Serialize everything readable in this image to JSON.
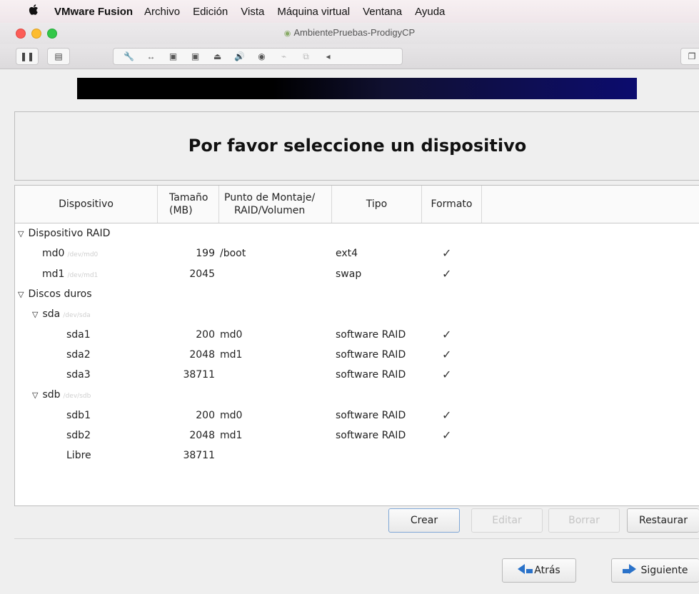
{
  "menubar": {
    "apple": "",
    "app": "VMware Fusion",
    "items": [
      "Archivo",
      "Edición",
      "Vista",
      "Máquina virtual",
      "Ventana",
      "Ayuda"
    ]
  },
  "window": {
    "title": "AmbientePruebas-ProdigyCP"
  },
  "toolbar": {
    "pause": "❚❚",
    "snapshot": "▤",
    "tools": [
      "🔧",
      "↔",
      "▣",
      "▣",
      "⏏",
      "🔊",
      "◉",
      "⌁",
      "⧉",
      "◂"
    ],
    "fullscreen": "❐"
  },
  "installer": {
    "heading": "Por favor seleccione un dispositivo",
    "columns": {
      "device": "Dispositivo",
      "size": "Tamaño\n(MB)",
      "mount": "Punto de Montaje/\nRAID/Volumen",
      "type": "Tipo",
      "format": "Formato"
    },
    "rows": [
      {
        "name": "Dispositivo RAID",
        "path": "",
        "size": "",
        "mount": "",
        "type": "",
        "format": false,
        "group": true,
        "level": 0
      },
      {
        "name": "md0",
        "path": "/dev/md0",
        "size": "199",
        "mount": "/boot",
        "type": "ext4",
        "format": true,
        "group": false,
        "level": 1
      },
      {
        "name": "md1",
        "path": "/dev/md1",
        "size": "2045",
        "mount": "",
        "type": "swap",
        "format": true,
        "group": false,
        "level": 1
      },
      {
        "name": "Discos duros",
        "path": "",
        "size": "",
        "mount": "",
        "type": "",
        "format": false,
        "group": true,
        "level": 0
      },
      {
        "name": "sda",
        "path": "/dev/sda",
        "size": "",
        "mount": "",
        "type": "",
        "format": false,
        "group": true,
        "level": 1
      },
      {
        "name": "sda1",
        "path": "",
        "size": "200",
        "mount": "md0",
        "type": "software RAID",
        "format": true,
        "group": false,
        "level": 2
      },
      {
        "name": "sda2",
        "path": "",
        "size": "2048",
        "mount": "md1",
        "type": "software RAID",
        "format": true,
        "group": false,
        "level": 2
      },
      {
        "name": "sda3",
        "path": "",
        "size": "38711",
        "mount": "",
        "type": "software RAID",
        "format": true,
        "group": false,
        "level": 2
      },
      {
        "name": "sdb",
        "path": "/dev/sdb",
        "size": "",
        "mount": "",
        "type": "",
        "format": false,
        "group": true,
        "level": 1
      },
      {
        "name": "sdb1",
        "path": "",
        "size": "200",
        "mount": "md0",
        "type": "software RAID",
        "format": true,
        "group": false,
        "level": 2
      },
      {
        "name": "sdb2",
        "path": "",
        "size": "2048",
        "mount": "md1",
        "type": "software RAID",
        "format": true,
        "group": false,
        "level": 2
      },
      {
        "name": "Libre",
        "path": "",
        "size": "38711",
        "mount": "",
        "type": "",
        "format": false,
        "group": false,
        "level": 2
      }
    ],
    "buttons": {
      "create": "Crear",
      "edit": "Editar",
      "delete": "Borrar",
      "reset": "Restaurar",
      "back": "Atrás",
      "next": "Siguiente"
    },
    "checkmark": "✓",
    "expander": "▽"
  },
  "colors": {
    "accent": "#2a72c9",
    "banner_end": "#0c0c6e"
  }
}
